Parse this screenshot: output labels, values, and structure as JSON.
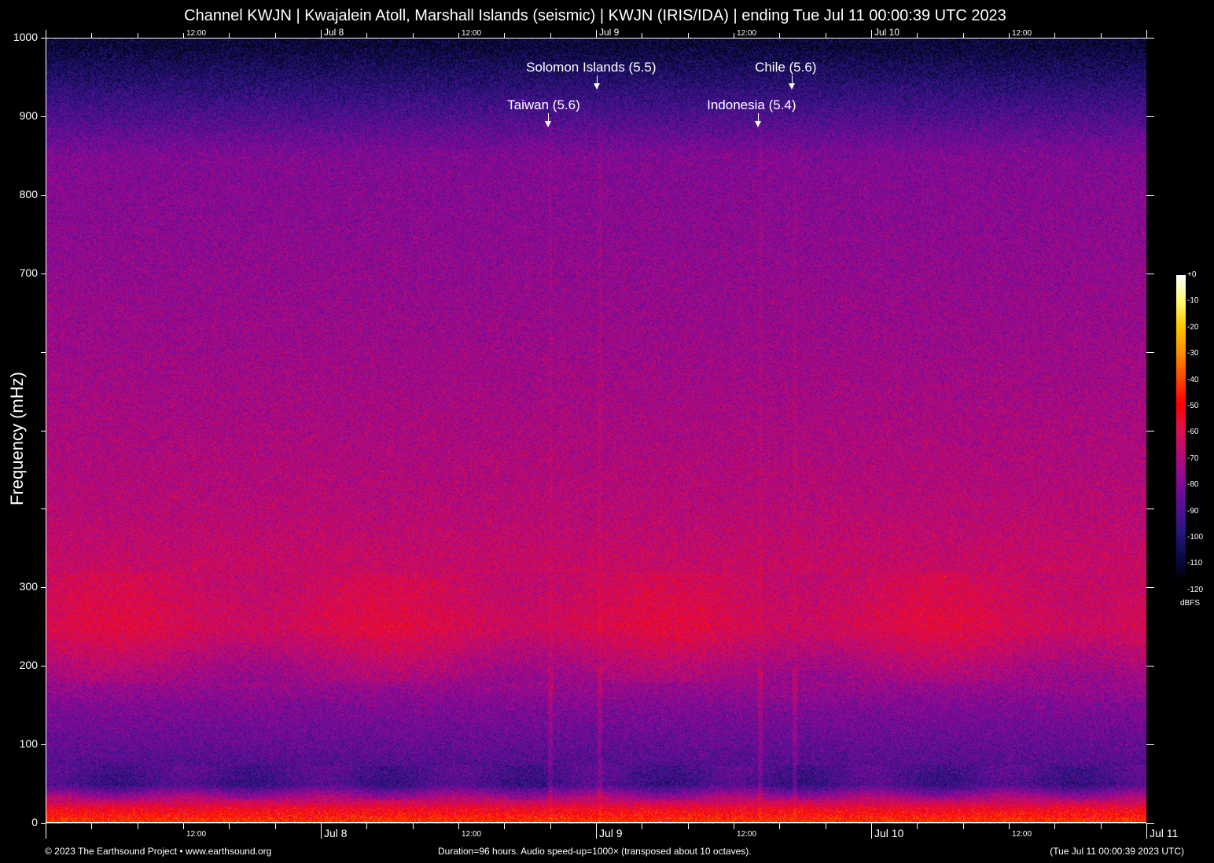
{
  "title": "Channel KWJN | Kwajalein Atoll, Marshall Islands (seismic) | KWJN (IRIS/IDA) | ending Tue Jul 11 00:00:39 UTC 2023",
  "footer": {
    "copyright": "© 2023 The Earthsound Project • www.earthsound.org",
    "duration": "Duration=96 hours. Audio speed-up=1000× (transposed about 10 octaves).",
    "timestamp": "(Tue Jul 11 00:00:39 2023 UTC)"
  },
  "chart_data": {
    "type": "heatmap",
    "title": "Channel KWJN | Kwajalein Atoll, Marshall Islands (seismic) | KWJN (IRIS/IDA) | ending Tue Jul 11 00:00:39 UTC 2023",
    "ylabel": "Frequency (mHz)",
    "xlabel": "",
    "ylim": [
      0,
      1000
    ],
    "xlim_hours": [
      0,
      96
    ],
    "y_ticks": [
      0,
      100,
      200,
      300,
      400,
      500,
      600,
      700,
      800,
      900,
      1000
    ],
    "y_tick_labels": [
      "0",
      "100",
      "200",
      "300",
      "",
      "",
      "",
      "700",
      "800",
      "900",
      "1000"
    ],
    "x_tick_interval_hours": 4,
    "x_labels": [
      {
        "hour": 12,
        "text": "12:00",
        "major": false
      },
      {
        "hour": 24,
        "text": "Jul  8",
        "major": true
      },
      {
        "hour": 36,
        "text": "12:00",
        "major": false
      },
      {
        "hour": 48,
        "text": "Jul  9",
        "major": true
      },
      {
        "hour": 60,
        "text": "12:00",
        "major": false
      },
      {
        "hour": 72,
        "text": "Jul 10",
        "major": true
      },
      {
        "hour": 84,
        "text": "12:00",
        "major": false
      },
      {
        "hour": 96,
        "text": "Jul 11",
        "major": true
      }
    ],
    "top_x_labels": [
      {
        "hour": 12,
        "text": "12:00"
      },
      {
        "hour": 24,
        "text": "Jul  8"
      },
      {
        "hour": 36,
        "text": "12:00"
      },
      {
        "hour": 48,
        "text": "Jul  9"
      },
      {
        "hour": 60,
        "text": "12:00"
      },
      {
        "hour": 72,
        "text": "Jul 10"
      },
      {
        "hour": 84,
        "text": "12:00"
      }
    ],
    "annotations": [
      {
        "text": "Solomon Islands (5.5)",
        "hour": 48.1,
        "row": 1
      },
      {
        "text": "Chile (5.6)",
        "hour": 65.1,
        "row": 1
      },
      {
        "text": "Taiwan (5.6)",
        "hour": 43.8,
        "row": 2
      },
      {
        "text": "Indonesia (5.4)",
        "hour": 62.1,
        "row": 2
      }
    ],
    "colorbar": {
      "label": "dBFS",
      "range": [
        -120,
        0
      ],
      "ticks": [
        "+0",
        "-10",
        "-20",
        "-30",
        "-40",
        "-50",
        "-60",
        "-70",
        "-80",
        "-90",
        "-100",
        "-110",
        "-120"
      ],
      "colors": [
        "#000000",
        "#0a0a4a",
        "#2a1680",
        "#5a0e98",
        "#8a0a98",
        "#b80a78",
        "#e0104a",
        "#ff0000",
        "#ff4a00",
        "#ff9000",
        "#ffc800",
        "#ffff70",
        "#ffffff"
      ]
    },
    "approx_level_by_frequency_dBFS": [
      {
        "f": 5,
        "db": -45
      },
      {
        "f": 20,
        "db": -55
      },
      {
        "f": 50,
        "db": -95
      },
      {
        "f": 85,
        "db": -90
      },
      {
        "f": 150,
        "db": -82
      },
      {
        "f": 250,
        "db": -62
      },
      {
        "f": 400,
        "db": -70
      },
      {
        "f": 600,
        "db": -76
      },
      {
        "f": 850,
        "db": -82
      },
      {
        "f": 990,
        "db": -112
      }
    ]
  }
}
